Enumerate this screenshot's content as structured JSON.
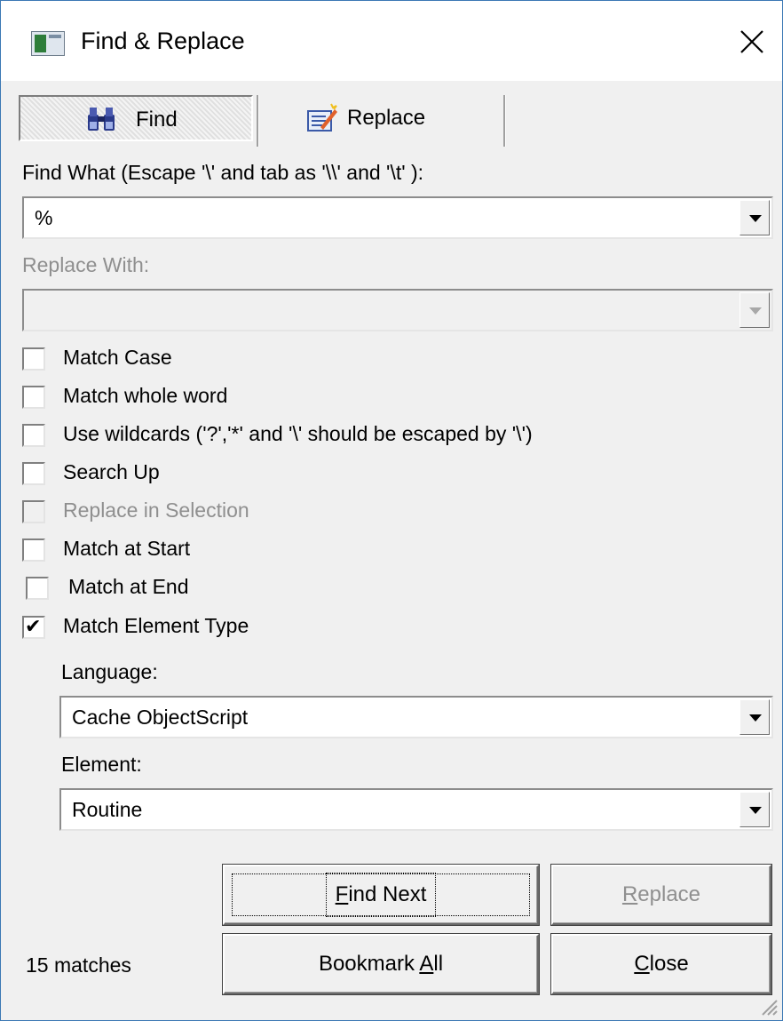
{
  "window": {
    "title": "Find & Replace",
    "app_icon": "dialog-app-icon",
    "close_icon": "close-icon"
  },
  "tabs": [
    {
      "label": "Find",
      "icon": "binoculars-icon",
      "selected": true
    },
    {
      "label": "Replace",
      "icon": "replace-edit-icon",
      "selected": false
    }
  ],
  "find": {
    "label": "Find What (Escape '\\' and tab as '\\\\' and '\\t' ):",
    "value": "%"
  },
  "replace": {
    "label": "Replace With:",
    "value": "",
    "enabled": false
  },
  "options": [
    {
      "label": "Match Case",
      "checked": false,
      "enabled": true
    },
    {
      "label": "Match whole word",
      "checked": false,
      "enabled": true
    },
    {
      "label": "Use wildcards ('?','*' and '\\' should be escaped by '\\')",
      "checked": false,
      "enabled": true
    },
    {
      "label": "Search Up",
      "checked": false,
      "enabled": true
    },
    {
      "label": "Replace in Selection",
      "checked": false,
      "enabled": false
    },
    {
      "label": "Match at Start",
      "checked": false,
      "enabled": true
    },
    {
      "label": "Match at End",
      "checked": false,
      "enabled": true
    },
    {
      "label": "Match Element Type",
      "checked": true,
      "enabled": true
    }
  ],
  "language": {
    "label": "Language:",
    "value": "Cache ObjectScript"
  },
  "element": {
    "label": "Element:",
    "value": "Routine"
  },
  "buttons": {
    "find_next": {
      "label": "Find Next",
      "mnemonic": "F"
    },
    "replace": {
      "label": "Replace",
      "mnemonic": "R",
      "enabled": false
    },
    "bookmark_all": {
      "label": "Bookmark All",
      "mnemonic": "A"
    },
    "close": {
      "label": "Close",
      "mnemonic": "C"
    }
  },
  "status": "15 matches",
  "colors": {
    "window_border": "#3c78b4",
    "dialog_bg": "#f0f0f0",
    "disabled_text": "#8f8f8f"
  }
}
